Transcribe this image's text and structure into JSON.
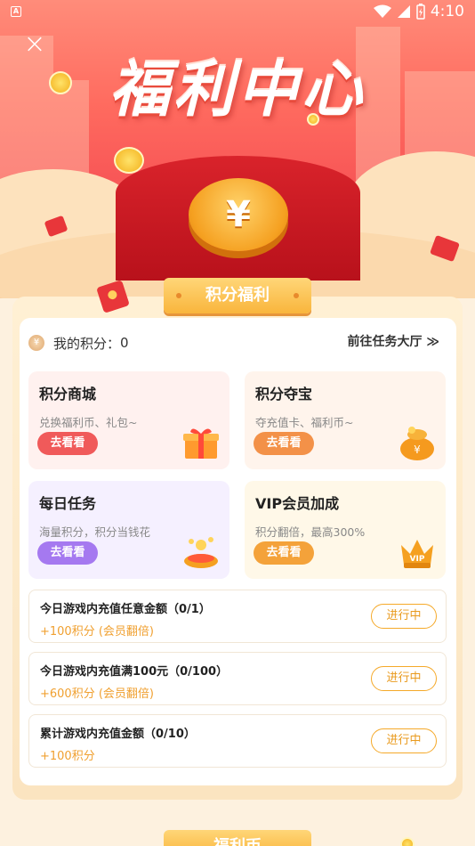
{
  "status_bar": {
    "time": "4:10",
    "left_badge": "A"
  },
  "hero": {
    "title": "福利中心",
    "coin_symbol": "¥",
    "close_icon": "close-icon"
  },
  "section": {
    "tab_label": "积分福利"
  },
  "points": {
    "label": "我的积分：",
    "value": "0",
    "tasks_link": "前往任务大厅 ≫"
  },
  "cards": [
    {
      "title": "积分商城",
      "desc": "兑换福利币、礼包~",
      "button": "去看看",
      "icon": "gift-box-icon",
      "bg": "#fff1ef",
      "btn": "#f05a5a"
    },
    {
      "title": "积分夺宝",
      "desc": "夺充值卡、福利币~",
      "button": "去看看",
      "icon": "money-bag-icon",
      "bg": "#fff4ec",
      "btn": "#f39148"
    },
    {
      "title": "每日任务",
      "desc": "海量积分，积分当钱花",
      "button": "去看看",
      "icon": "coins-bowl-icon",
      "bg": "#f5f0ff",
      "btn": "#a579f0"
    },
    {
      "title": "VIP会员加成",
      "desc": "积分翻倍，最高300%",
      "button": "去看看",
      "icon": "vip-crown-icon",
      "bg": "#fff8e8",
      "btn": "#f4a23a"
    }
  ],
  "tasks": [
    {
      "title": "今日游戏内充值任意金额（0/1）",
      "reward": "+100积分 (会员翻倍)",
      "status": "进行中"
    },
    {
      "title": "今日游戏内充值满100元（0/100）",
      "reward": "+600积分 (会员翻倍)",
      "status": "进行中"
    },
    {
      "title": "累计游戏内充值金额（0/10）",
      "reward": "+100积分",
      "status": "进行中"
    }
  ],
  "bottom_tab": {
    "label": "福利币"
  }
}
